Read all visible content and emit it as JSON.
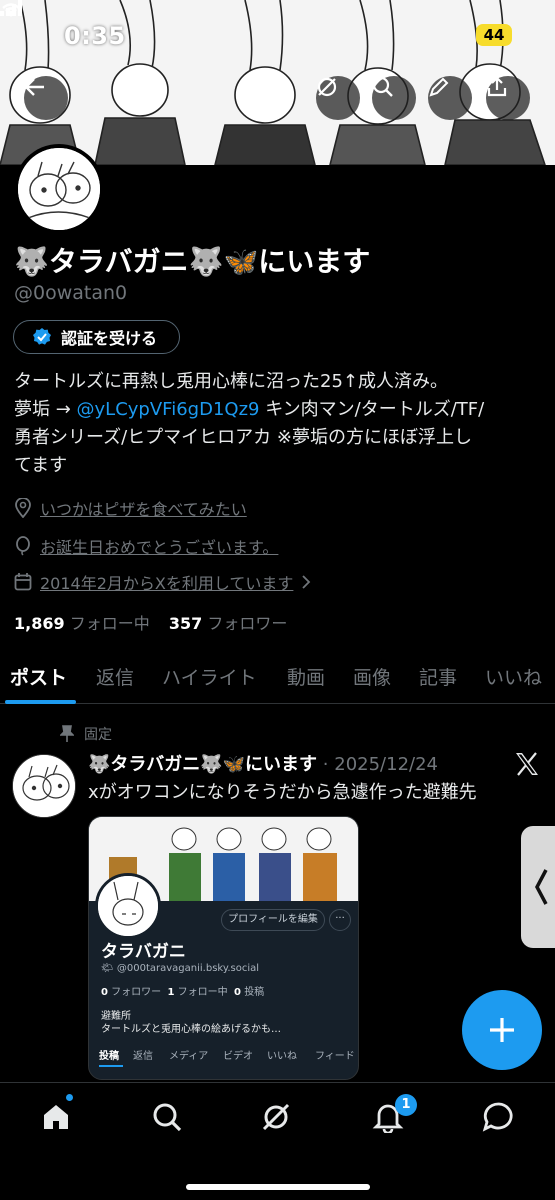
{
  "status_bar": {
    "time": "0:35",
    "battery": "44"
  },
  "profile": {
    "name": "🐺タラバガニ🐺🦋にいます",
    "handle": "@0owatan0",
    "verify_label": "認証を受ける",
    "bio_line1": "タートルズに再熱し兎用心棒に沼った25↑成人済み。",
    "bio_line2_pre": "夢垢 → ",
    "bio_line2_link": "@yLCypVFi6gD1Qz9",
    "bio_line2_post": " キン肉マン/タートルズ/TF/",
    "bio_line3": "勇者シリーズ/ヒプマイヒロアカ ※夢垢の方にほぼ浮上し",
    "bio_line4": "てます",
    "location": "いつかはピザを食べてみたい",
    "birthday": "お誕生日おめでとうございます。",
    "joined": "2014年2月からXを利用しています",
    "following_count": "1,869",
    "following_label": "フォロー中",
    "followers_count": "357",
    "followers_label": "フォロワー"
  },
  "tabs": [
    "ポスト",
    "返信",
    "ハイライト",
    "動画",
    "画像",
    "記事",
    "いいね"
  ],
  "pinned_post": {
    "pinned_label": "固定",
    "author": "🐺タラバガニ🐺🦋にいます",
    "date": "· 2025/12/24",
    "text": "xがオワコンになりそうだから急遽作った避難先",
    "card": {
      "edit_label": "プロフィールを編集",
      "more_label": "···",
      "name": "タラバガニ",
      "handle": "@000taravaganii.bsky.social",
      "followers_count": "0",
      "followers_label": "フォロワー",
      "following_count": "1",
      "following_label": "フォロー中",
      "posts_count": "0",
      "posts_label": "投稿",
      "bio_line1": "避難所",
      "bio_line2": "タートルズと兎用心棒の絵あげるかも…",
      "tabs": [
        "投稿",
        "返信",
        "メディア",
        "ビデオ",
        "いいね",
        "フィード"
      ]
    }
  },
  "nav": {
    "notification_badge": "1"
  },
  "colors": {
    "accent": "#1d9bf0",
    "background": "#000000",
    "muted": "#71767b",
    "battery": "#f7dc2c"
  }
}
